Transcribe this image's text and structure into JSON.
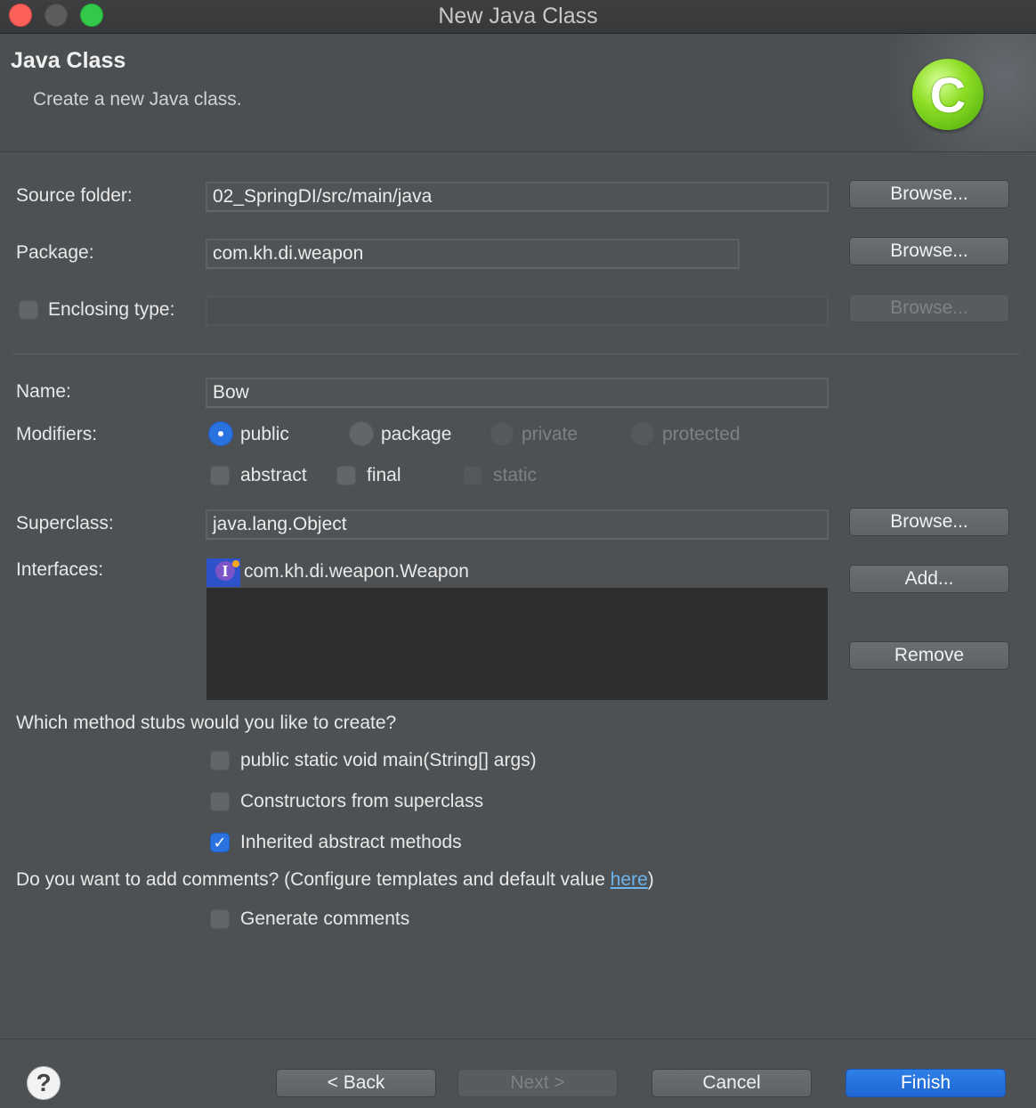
{
  "window": {
    "title": "New Java Class"
  },
  "banner": {
    "title": "Java Class",
    "description": "Create a new Java class.",
    "icon_letter": "C"
  },
  "form": {
    "source_folder": {
      "label": "Source folder:",
      "value": "02_SpringDI/src/main/java",
      "browse": "Browse..."
    },
    "package": {
      "label": "Package:",
      "value": "com.kh.di.weapon",
      "browse": "Browse..."
    },
    "enclosing_type": {
      "label": "Enclosing type:",
      "value": "",
      "browse": "Browse...",
      "checked": false
    },
    "name": {
      "label": "Name:",
      "value": "Bow"
    },
    "modifiers": {
      "label": "Modifiers:",
      "access": [
        {
          "label": "public",
          "selected": true,
          "enabled": true
        },
        {
          "label": "package",
          "selected": false,
          "enabled": true
        },
        {
          "label": "private",
          "selected": false,
          "enabled": false
        },
        {
          "label": "protected",
          "selected": false,
          "enabled": false
        }
      ],
      "flags": [
        {
          "label": "abstract",
          "checked": false,
          "enabled": true
        },
        {
          "label": "final",
          "checked": false,
          "enabled": true
        },
        {
          "label": "static",
          "checked": false,
          "enabled": false
        }
      ]
    },
    "superclass": {
      "label": "Superclass:",
      "value": "java.lang.Object",
      "browse": "Browse..."
    },
    "interfaces": {
      "label": "Interfaces:",
      "items": [
        "com.kh.di.weapon.Weapon"
      ],
      "add": "Add...",
      "remove": "Remove"
    },
    "stubs": {
      "question": "Which method stubs would you like to create?",
      "options": [
        {
          "label": "public static void main(String[] args)",
          "checked": false
        },
        {
          "label": "Constructors from superclass",
          "checked": false
        },
        {
          "label": "Inherited abstract methods",
          "checked": true
        }
      ]
    },
    "comments": {
      "question": "Do you want to add comments? (Configure templates and default value ",
      "link": "here",
      "question_end": ")",
      "option": {
        "label": "Generate comments",
        "checked": false
      }
    }
  },
  "footer": {
    "help": "?",
    "back": "< Back",
    "next": "Next >",
    "cancel": "Cancel",
    "finish": "Finish"
  }
}
